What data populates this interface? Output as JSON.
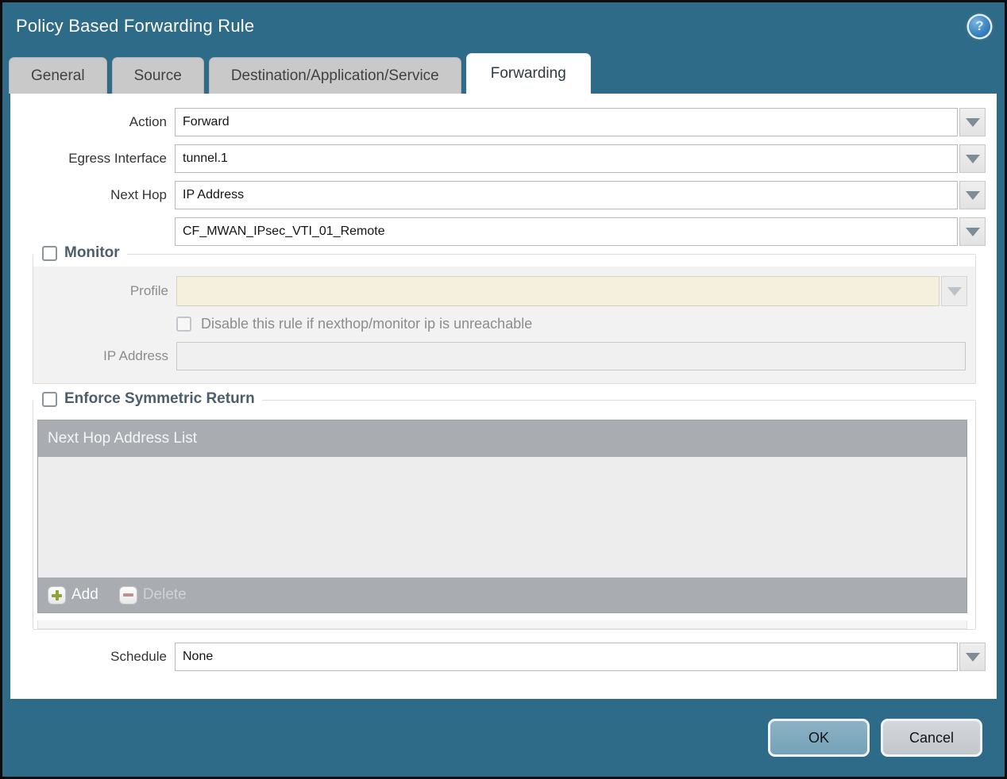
{
  "dialog": {
    "title": "Policy Based Forwarding Rule"
  },
  "icons": {
    "help": "?"
  },
  "tabs": [
    {
      "label": "General",
      "active": false
    },
    {
      "label": "Source",
      "active": false
    },
    {
      "label": "Destination/Application/Service",
      "active": false
    },
    {
      "label": "Forwarding",
      "active": true
    }
  ],
  "form": {
    "action": {
      "label": "Action",
      "value": "Forward"
    },
    "egress_interface": {
      "label": "Egress Interface",
      "value": "tunnel.1"
    },
    "next_hop": {
      "label": "Next Hop",
      "value": "IP Address"
    },
    "next_hop_address": {
      "value": "CF_MWAN_IPsec_VTI_01_Remote"
    },
    "schedule": {
      "label": "Schedule",
      "value": "None"
    }
  },
  "monitor": {
    "title": "Monitor",
    "checked": false,
    "profile": {
      "label": "Profile",
      "value": ""
    },
    "disable_rule": {
      "label": "Disable this rule if nexthop/monitor ip is unreachable",
      "checked": false
    },
    "ip_address": {
      "label": "IP Address",
      "value": ""
    }
  },
  "enforce_symmetric_return": {
    "title": "Enforce Symmetric Return",
    "checked": false,
    "table": {
      "header": "Next Hop Address List",
      "rows": []
    },
    "add_label": "Add",
    "delete_label": "Delete"
  },
  "footer": {
    "ok_label": "OK",
    "cancel_label": "Cancel"
  },
  "colors": {
    "titlebar_teal": "#2e6b88",
    "tab_inactive_gray": "#c9c9c9",
    "table_header_gray": "#a9adb2",
    "disabled_field_beige": "#f5f0dd",
    "ok_button_blue": "#74a2b8",
    "section_title_slate": "#4d5d6b",
    "add_icon_green": "#8fa23c"
  }
}
